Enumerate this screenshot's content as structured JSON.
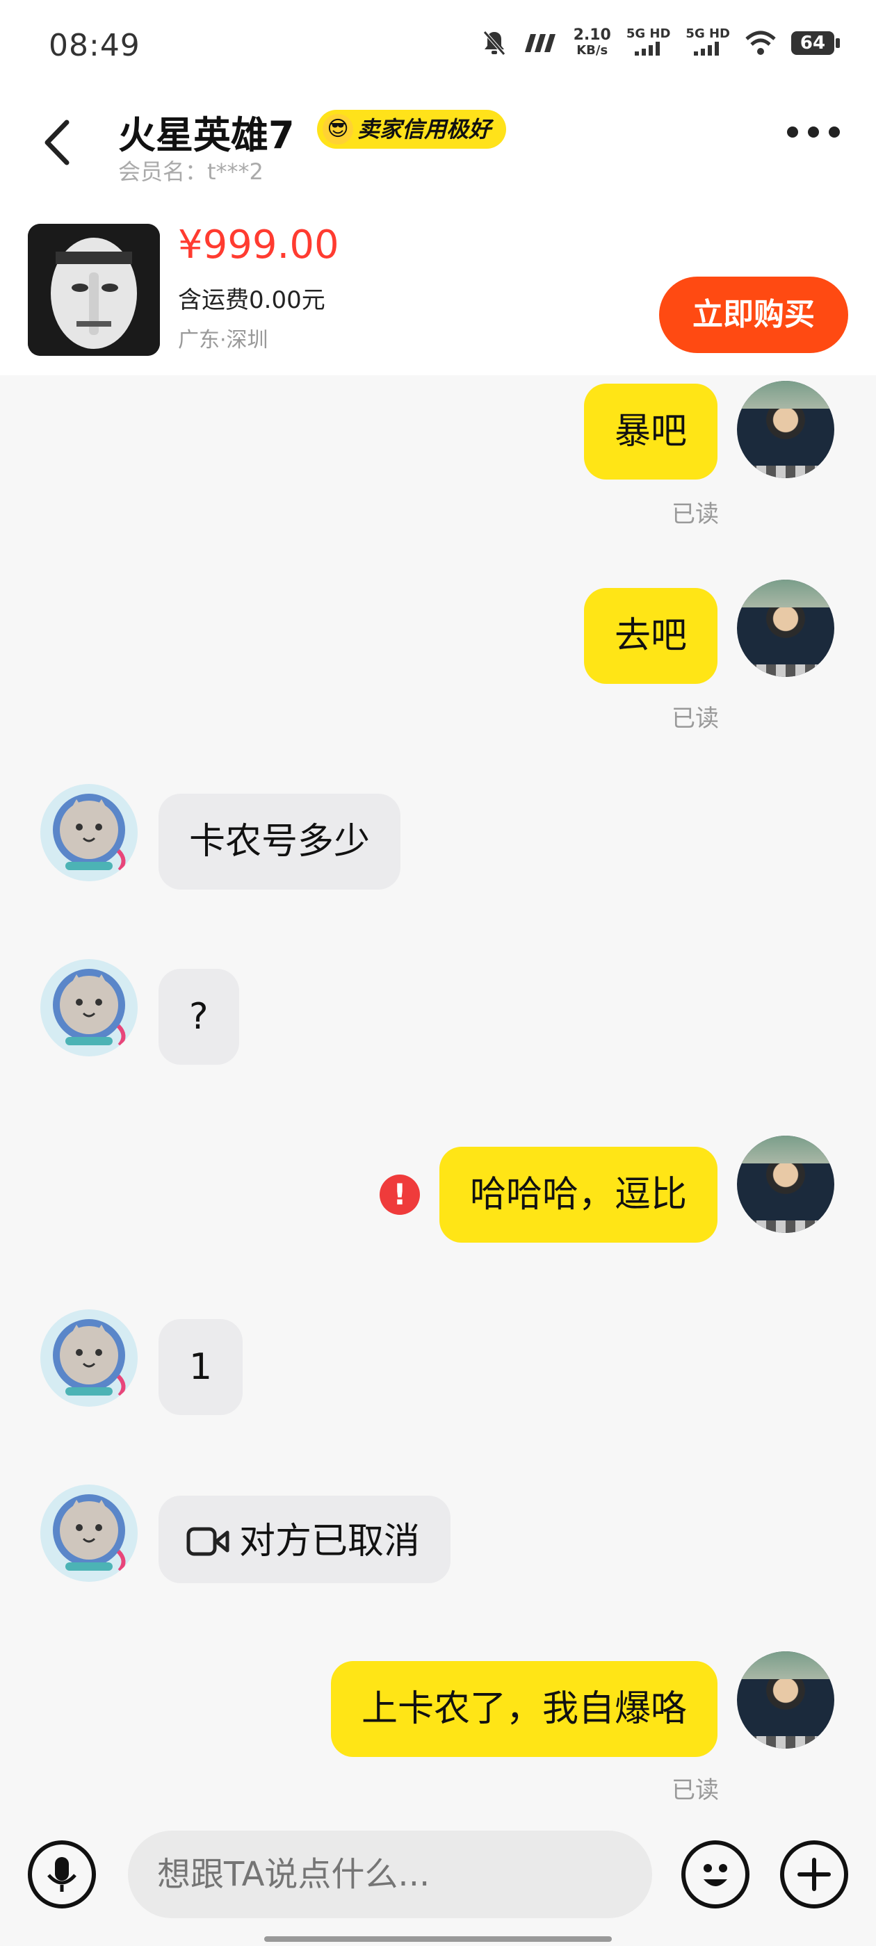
{
  "status_bar": {
    "time": "08:49",
    "network_speed_value": "2.10",
    "network_speed_unit": "KB/s",
    "signal_1": "5G HD",
    "signal_2": "5G HD",
    "battery": "64"
  },
  "header": {
    "seller_name": "火星英雄7",
    "credit_badge": "卖家信用极好",
    "member_name": "会员名：t***2"
  },
  "product": {
    "price": "¥999.00",
    "shipping": "含运费0.00元",
    "location": "广东·深圳",
    "buy_label": "立即购买"
  },
  "messages": [
    {
      "from": "me",
      "text": "暴吧",
      "status": "已读"
    },
    {
      "from": "me",
      "text": "去吧",
      "status": "已读"
    },
    {
      "from": "them",
      "text": "卡农号多少"
    },
    {
      "from": "them",
      "text": "?"
    },
    {
      "from": "me",
      "text": "哈哈哈，逗比",
      "status": "send-failed"
    },
    {
      "from": "them",
      "text": "1"
    },
    {
      "from": "them",
      "text": "对方已取消",
      "type": "video-call"
    },
    {
      "from": "me",
      "text": "上卡农了，我自爆咯",
      "status": "已读"
    }
  ],
  "input": {
    "placeholder": "想跟TA说点什么..."
  },
  "colors": {
    "accent_yellow": "#ffe516",
    "buy_orange": "#ff4a12",
    "price_red": "#ff3b30",
    "error_red": "#ef3b3b"
  }
}
